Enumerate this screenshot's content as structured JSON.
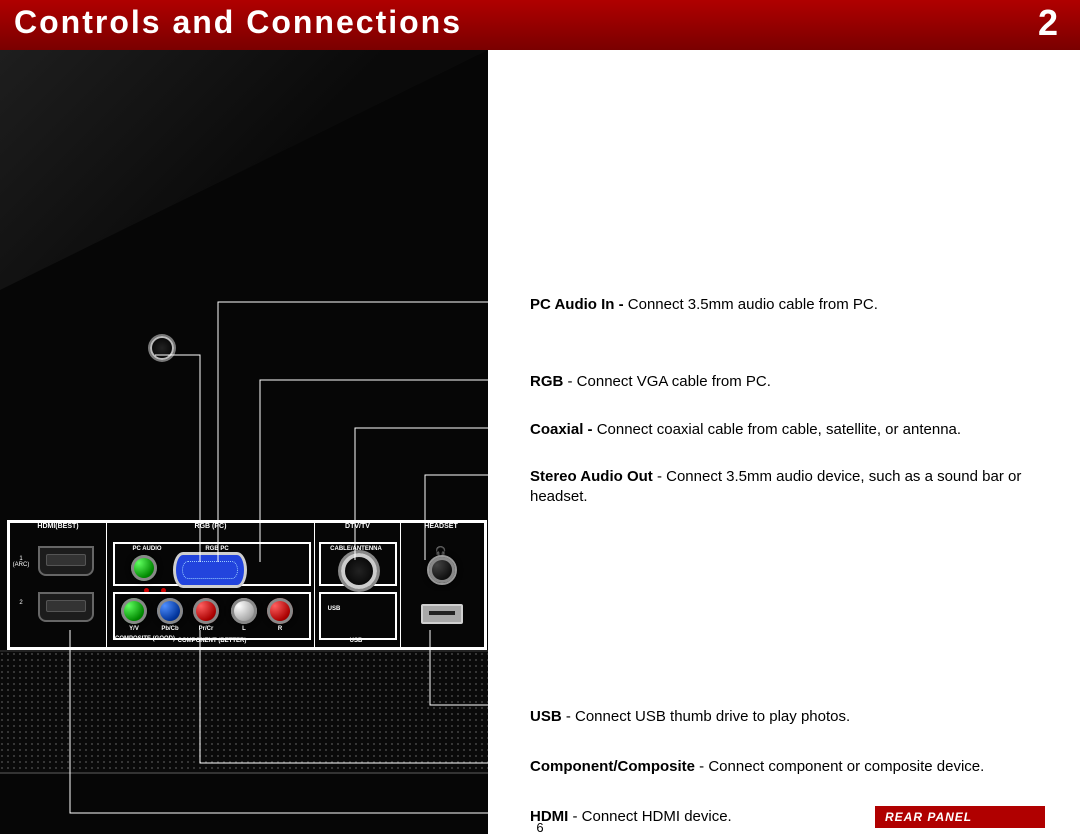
{
  "header": {
    "title": "Controls and Connections",
    "chapter": "2"
  },
  "panel_columns": {
    "c1": "HDMI(BEST)",
    "c2": "RGB (PC)",
    "c3": "DTV/TV",
    "c4": "HEADSET"
  },
  "panel_sub": {
    "hdmi1": "1 (ARC)",
    "hdmi2": "2",
    "pcaudio": "PC AUDIO",
    "rgbpc": "RGB PC",
    "cable": "CABLE/ANTENNA",
    "headset_icon": "🎧",
    "yv": "Y/V",
    "pbcb": "Pb/Cb",
    "prcr": "Pr/Cr",
    "l": "L",
    "r": "R",
    "usb_small": "USB",
    "composite": "COMPOSITE (GOOD)",
    "component": "COMPONENT (BETTER)",
    "usb_big": "USB"
  },
  "desc": {
    "d1_b": "PC Audio In - ",
    "d1": "Connect 3.5mm audio cable from PC.",
    "d2_b": "RGB",
    "d2": " - Connect VGA cable from PC.",
    "d3_b": "Coaxial - ",
    "d3": "Connect coaxial cable from cable, satellite, or antenna.",
    "d4_b": "Stereo Audio Out",
    "d4": " - Connect 3.5mm audio device, such as a sound bar or headset.",
    "d5_b": "USB",
    "d5": " - Connect USB thumb drive to play photos.",
    "d6_b": "Component/Composite",
    "d6": " - Connect component or composite device.",
    "d7_b": "HDMI",
    "d7": " - Connect HDMI device."
  },
  "footer": {
    "rear": "REAR PANEL",
    "page": "6"
  }
}
